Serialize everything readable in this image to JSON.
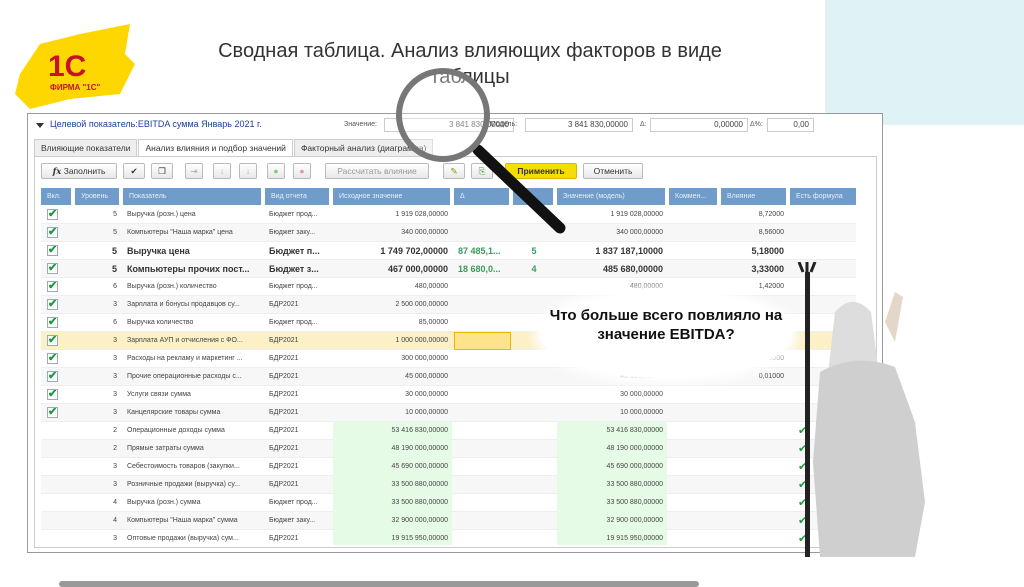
{
  "slide": {
    "title": "Сводная таблица. Анализ влияющих факторов в виде таблицы",
    "logo_text": "ФИРМА \"1С\"",
    "bubble": "Что больше всего повлияло на значение EBITDA?"
  },
  "colors": {
    "accent": "#f5dd00",
    "header": "#6f9cc9",
    "logo_red": "#c8102e"
  },
  "window": {
    "target": "Целевой показатель:EBITDA сумма Январь 2021 г.",
    "value_label": "Значение:",
    "value": "3 841 830,00000",
    "model_label": "Модель:",
    "model": "3 841 830,00000",
    "delta_label": "Δ:",
    "delta": "0,00000",
    "delta_pct_label": "Δ%:",
    "delta_pct": "0,00",
    "tabs": [
      "Влияющие показатели",
      "Анализ влияния и подбор значений",
      "Факторный анализ (диаграмма)"
    ],
    "toolbar": {
      "fill": "Заполнить",
      "calc": "Рассчитать влияние",
      "apply": "Применить",
      "cancel": "Отменить"
    },
    "columns": [
      "Вкл.",
      "Уровень",
      "Показатель",
      "Вид отчета",
      "Исходное значение",
      "Δ",
      "",
      "Значение (модель)",
      "Коммен...",
      "Влияние",
      "Есть формула"
    ],
    "rows": [
      {
        "on": true,
        "lvl": "5",
        "name": "Выручка (розн.) цена",
        "rep": "Бюджет прод...",
        "src": "1 919 028,00000",
        "d": "",
        "n": "",
        "model": "1 919 028,00000",
        "inf": "8,72000"
      },
      {
        "on": true,
        "lvl": "5",
        "name": "Компьютеры \"Наша марка\" цена",
        "rep": "Бюджет заку...",
        "src": "340 000,00000",
        "d": "",
        "n": "",
        "model": "340 000,00000",
        "inf": "8,56000"
      },
      {
        "on": true,
        "bold": true,
        "lvl": "5",
        "name": "Выручка цена",
        "rep": "Бюджет п...",
        "src": "1 749 702,00000",
        "d": "87 485,1...",
        "n": "5",
        "model": "1 837 187,10000",
        "inf": "5,18000"
      },
      {
        "on": true,
        "bold": true,
        "lvl": "5",
        "name": "Компьютеры прочих пост...",
        "rep": "Бюджет з...",
        "src": "467 000,00000",
        "d": "18 680,0...",
        "n": "4",
        "model": "485 680,00000",
        "inf": "3,33000"
      },
      {
        "on": true,
        "lvl": "6",
        "name": "Выручка (розн.) количество",
        "rep": "Бюджет прод...",
        "src": "480,00000",
        "d": "",
        "n": "",
        "model": "480,00000",
        "inf": "1,42000"
      },
      {
        "on": true,
        "lvl": "3",
        "name": "Зарплата и бонусы продавцов су...",
        "rep": "БДР2021",
        "src": "2 500 000,00000",
        "d": "",
        "n": "",
        "model": "",
        "inf": ""
      },
      {
        "on": true,
        "lvl": "6",
        "name": "Выручка количество",
        "rep": "Бюджет прод...",
        "src": "85,00000",
        "d": "",
        "n": "",
        "model": "",
        "inf": ""
      },
      {
        "on": true,
        "sel": true,
        "lvl": "3",
        "name": "Зарплата АУП и отчисления с ФО...",
        "rep": "БДР2021",
        "src": "1 000 000,00000",
        "d": "",
        "n": "",
        "model": "",
        "inf": ""
      },
      {
        "on": true,
        "lvl": "3",
        "name": "Расходы на рекламу и маркетинг ...",
        "rep": "БДР2021",
        "src": "300 000,00000",
        "d": "",
        "n": "",
        "model": "",
        "inf": "0,08000"
      },
      {
        "on": true,
        "lvl": "3",
        "name": "Прочие операционные расходы с...",
        "rep": "БДР2021",
        "src": "45 000,00000",
        "d": "",
        "n": "",
        "model": "45 000,00000",
        "inf": "0,01000"
      },
      {
        "on": true,
        "lvl": "3",
        "name": "Услуги связи сумма",
        "rep": "БДР2021",
        "src": "30 000,00000",
        "d": "",
        "n": "",
        "model": "30 000,00000",
        "inf": ""
      },
      {
        "on": true,
        "lvl": "3",
        "name": "Канцелярские товары сумма",
        "rep": "БДР2021",
        "src": "10 000,00000",
        "d": "",
        "n": "",
        "model": "10 000,00000",
        "inf": ""
      },
      {
        "on": false,
        "f": true,
        "lvl": "2",
        "name": "Операционные доходы сумма",
        "rep": "БДР2021",
        "src": "53 416 830,00000",
        "d": "",
        "n": "",
        "model": "53 416 830,00000",
        "inf": ""
      },
      {
        "on": false,
        "f": true,
        "lvl": "2",
        "name": "Прямые затраты сумма",
        "rep": "БДР2021",
        "src": "48 190 000,00000",
        "d": "",
        "n": "",
        "model": "48 190 000,00000",
        "inf": ""
      },
      {
        "on": false,
        "f": true,
        "lvl": "3",
        "name": "Себестоимость товаров (закупки...",
        "rep": "БДР2021",
        "src": "45 690 000,00000",
        "d": "",
        "n": "",
        "model": "45 690 000,00000",
        "inf": ""
      },
      {
        "on": false,
        "f": true,
        "lvl": "3",
        "name": "Розничные продажи (выручка) су...",
        "rep": "БДР2021",
        "src": "33 500 880,00000",
        "d": "",
        "n": "",
        "model": "33 500 880,00000",
        "inf": ""
      },
      {
        "on": false,
        "f": true,
        "lvl": "4",
        "name": "Выручка (розн.) сумма",
        "rep": "Бюджет прод...",
        "src": "33 500 880,00000",
        "d": "",
        "n": "",
        "model": "33 500 880,00000",
        "inf": ""
      },
      {
        "on": false,
        "f": true,
        "lvl": "4",
        "name": "Компьютеры \"Наша марка\" сумма",
        "rep": "Бюджет заку...",
        "src": "32 900 000,00000",
        "d": "",
        "n": "",
        "model": "32 900 000,00000",
        "inf": ""
      },
      {
        "on": false,
        "f": true,
        "lvl": "3",
        "name": "Оптовые продажи (выручка) сум...",
        "rep": "БДР2021",
        "src": "19 915 950,00000",
        "d": "",
        "n": "",
        "model": "19 915 950,00000",
        "inf": ""
      }
    ]
  }
}
